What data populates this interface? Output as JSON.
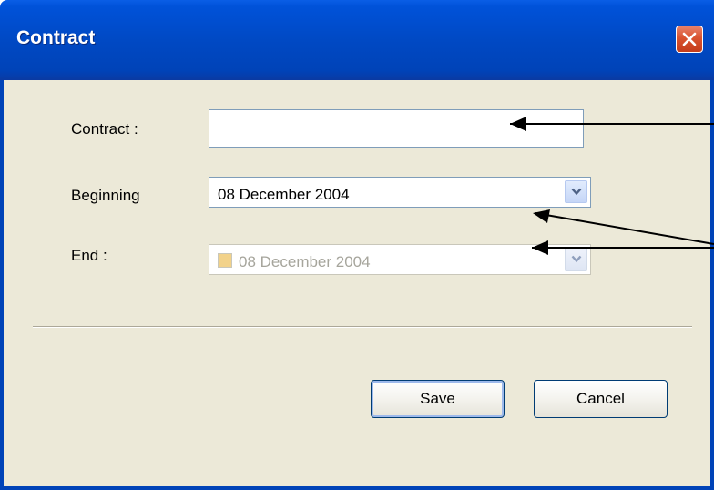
{
  "window": {
    "title": "Contract",
    "close_label": "×"
  },
  "form": {
    "contract": {
      "label": "Contract :",
      "value": ""
    },
    "beginning": {
      "label": "Beginning",
      "value": "08 December 2004"
    },
    "end": {
      "label": "End :",
      "value": "08 December 2004",
      "checked": false,
      "enabled": false
    }
  },
  "buttons": {
    "save_label": "Save",
    "cancel_label": "Cancel"
  },
  "colors": {
    "titlebar": "#0049c4",
    "dialog_bg": "#ece9d8",
    "close_red": "#d9532f",
    "input_border": "#7f9db9",
    "disabled_text": "#a6a59c"
  }
}
